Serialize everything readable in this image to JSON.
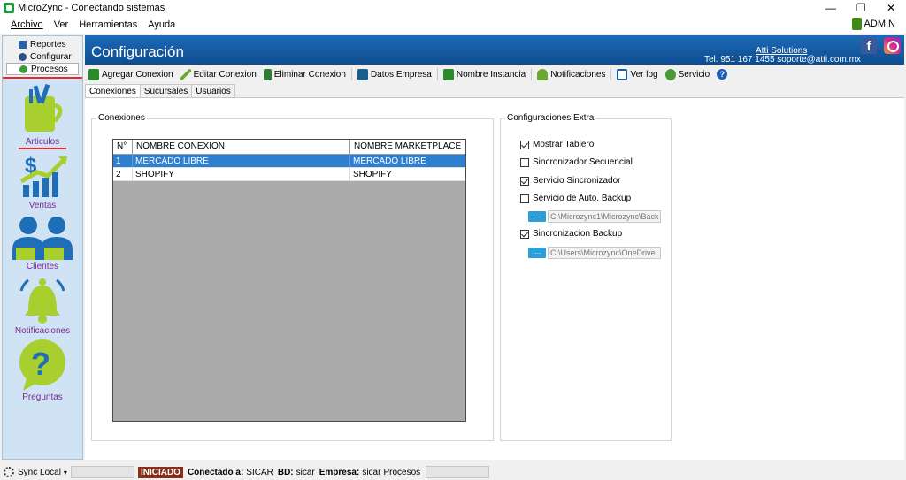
{
  "window": {
    "title": "MicroZync - Conectando sistemas",
    "controls": [
      "—",
      "❐",
      "✕"
    ]
  },
  "menu": [
    "Archivo",
    "Ver",
    "Herramientas",
    "Ayuda"
  ],
  "admin_label": "ADMIN",
  "nav": {
    "tabs": [
      "Reportes",
      "Configurar",
      "Procesos"
    ],
    "buttons": [
      "Articulos",
      "Ventas",
      "Clientes",
      "Notificaciones",
      "Preguntas"
    ]
  },
  "banner": {
    "title": "Configuración",
    "company": "Atti Solutions",
    "contact": "Tel. 951 167 1455  soporte@atti.com.mx",
    "facebook_glyph": "f"
  },
  "toolbar": {
    "agregar": "Agregar Conexion",
    "editar": "Editar Conexion",
    "eliminar": "Eliminar Conexion",
    "datos": "Datos Empresa",
    "instancia": "Nombre Instancia",
    "notificaciones": "Notificaciones",
    "log": "Ver log",
    "servicio": "Servicio",
    "help_glyph": "?"
  },
  "subtabs": [
    "Conexiones",
    "Sucursales",
    "Usuarios"
  ],
  "conexiones": {
    "title": "Conexiones",
    "columns": [
      "N°",
      "NOMBRE CONEXION",
      "NOMBRE MARKETPLACE"
    ],
    "rows": [
      [
        "1",
        "MERCADO LIBRE",
        "MERCADO LIBRE"
      ],
      [
        "2",
        "SHOPIFY",
        "SHOPIFY"
      ]
    ]
  },
  "extra": {
    "title": "Configuraciones Extra",
    "options": [
      {
        "label": "Mostrar Tablero",
        "checked": true
      },
      {
        "label": "Sincronizador Secuencial",
        "checked": false
      },
      {
        "label": "Servicio Sincronizador",
        "checked": true
      },
      {
        "label": "Servicio de Auto. Backup",
        "checked": false
      },
      {
        "label": "Sincronizacion Backup",
        "checked": true
      }
    ],
    "browse_label": "....",
    "backup_path": "C:\\Microzync1\\Microzync\\Back",
    "sync_path": "C:\\Users\\Microzync\\OneDrive"
  },
  "status": {
    "sync_label": "Sync Local",
    "caret": "▾",
    "state": "INICIADO",
    "conectado_label": "Conectado a:",
    "conectado_val": "SICAR",
    "bd_label": "BD:",
    "bd_val": "sicar",
    "empresa_label": "Empresa:",
    "empresa_val": "sicar",
    "procesos": "Procesos"
  },
  "colors": {
    "banner": "#1c6ab8",
    "selected_row": "#2f7fd0",
    "accent_red": "#e22a2a",
    "nav_label": "#7b2a91",
    "state_badge": "#8b2e1a"
  }
}
